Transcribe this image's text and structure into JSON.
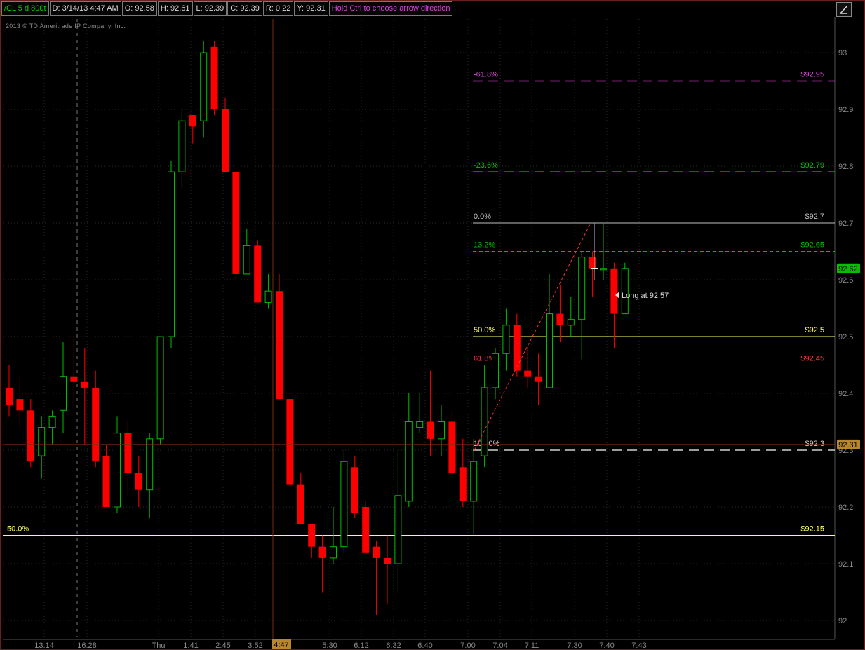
{
  "header": {
    "symbol": "/CL 5 d 800t",
    "date": "D: 3/14/13 4:47 AM",
    "open": "O: 92.58",
    "high": "H: 92.61",
    "low": "L: 92.39",
    "close": "C: 92.39",
    "range": "R: 0.22",
    "y": "Y: 92.31",
    "hint": "Hold Ctrl to choose arrow direction"
  },
  "copyright": "2013 © TD Ameritrade IP Company, Inc.",
  "cursor_label": "4:47",
  "annotation": "Long at 92.57",
  "colors": {
    "up": "#00c000",
    "down": "#ff0000",
    "background": "#000000"
  },
  "chart_data": {
    "type": "candlestick",
    "ylim": [
      91.98,
      93.08
    ],
    "y_ticks": [
      "93",
      "92.9",
      "92.8",
      "92.7",
      "92.6",
      "92.5",
      "92.4",
      "92.3",
      "92.2",
      "92.1",
      "92"
    ],
    "x_ticks": [
      "13:14",
      "16:28",
      "Thu",
      "1:41",
      "2:45",
      "3:52",
      "5:30",
      "6:12",
      "6:32",
      "6:40",
      "7:00",
      "7:04",
      "7:11",
      "7:30",
      "7:40",
      "7:43"
    ],
    "price_markers": [
      {
        "label": "92.62",
        "value": 92.62,
        "color": "#00c000"
      },
      {
        "label": "92.31",
        "value": 92.31,
        "color": "#b8862b"
      }
    ],
    "levels": [
      {
        "pct": "-61.8%",
        "price": "$92.95",
        "value": 92.95,
        "color": "#e040e0",
        "dash": "long",
        "scope": "right"
      },
      {
        "pct": "-23.6%",
        "price": "$92.79",
        "value": 92.79,
        "color": "#00c000",
        "dash": "long",
        "scope": "right"
      },
      {
        "pct": "0.0%",
        "price": "$92.7",
        "value": 92.7,
        "color": "#c0c0c0",
        "dash": "solid",
        "scope": "right"
      },
      {
        "pct": "13.2%",
        "price": "$92.65",
        "value": 92.65,
        "color": "#00c000",
        "dash": "short",
        "scope": "right"
      },
      {
        "pct": "50.0%",
        "price": "$92.5",
        "value": 92.5,
        "color": "#ffff66",
        "dash": "solid",
        "scope": "right"
      },
      {
        "pct": "61.8%",
        "price": "$92.45",
        "value": 92.45,
        "color": "#ff3030",
        "dash": "solid",
        "scope": "right"
      },
      {
        "pct": "100.0%",
        "price": "$92.3",
        "value": 92.3,
        "color": "#d0d0d0",
        "dash": "long",
        "scope": "right"
      },
      {
        "pct": "50.0%",
        "price": "$92.15",
        "value": 92.15,
        "color": "#ffff66",
        "dash": "solid",
        "scope": "full"
      }
    ],
    "candles": [
      {
        "o": 92.41,
        "h": 92.45,
        "l": 92.36,
        "c": 92.38
      },
      {
        "o": 92.39,
        "h": 92.43,
        "l": 92.34,
        "c": 92.37
      },
      {
        "o": 92.37,
        "h": 92.39,
        "l": 92.27,
        "c": 92.28
      },
      {
        "o": 92.29,
        "h": 92.36,
        "l": 92.25,
        "c": 92.34
      },
      {
        "o": 92.34,
        "h": 92.37,
        "l": 92.31,
        "c": 92.36
      },
      {
        "o": 92.37,
        "h": 92.49,
        "l": 92.33,
        "c": 92.43
      },
      {
        "o": 92.43,
        "h": 92.5,
        "l": 92.38,
        "c": 92.42
      },
      {
        "o": 92.42,
        "h": 92.48,
        "l": 92.31,
        "c": 92.41
      },
      {
        "o": 92.41,
        "h": 92.44,
        "l": 92.27,
        "c": 92.28
      },
      {
        "o": 92.29,
        "h": 92.31,
        "l": 92.2,
        "c": 92.2
      },
      {
        "o": 92.2,
        "h": 92.36,
        "l": 92.19,
        "c": 92.33
      },
      {
        "o": 92.33,
        "h": 92.35,
        "l": 92.22,
        "c": 92.26
      },
      {
        "o": 92.26,
        "h": 92.29,
        "l": 92.2,
        "c": 92.23
      },
      {
        "o": 92.23,
        "h": 92.33,
        "l": 92.18,
        "c": 92.32
      },
      {
        "o": 92.32,
        "h": 92.48,
        "l": 92.31,
        "c": 92.5
      },
      {
        "o": 92.5,
        "h": 92.81,
        "l": 92.48,
        "c": 92.79
      },
      {
        "o": 92.79,
        "h": 92.9,
        "l": 92.76,
        "c": 92.88
      },
      {
        "o": 92.89,
        "h": 92.89,
        "l": 92.84,
        "c": 92.87
      },
      {
        "o": 92.88,
        "h": 93.02,
        "l": 92.85,
        "c": 93.0
      },
      {
        "o": 93.01,
        "h": 93.02,
        "l": 92.89,
        "c": 92.9
      },
      {
        "o": 92.9,
        "h": 92.92,
        "l": 92.79,
        "c": 92.79
      },
      {
        "o": 92.79,
        "h": 92.79,
        "l": 92.6,
        "c": 92.61
      },
      {
        "o": 92.61,
        "h": 92.69,
        "l": 92.61,
        "c": 92.66
      },
      {
        "o": 92.66,
        "h": 92.67,
        "l": 92.56,
        "c": 92.56
      },
      {
        "o": 92.56,
        "h": 92.61,
        "l": 92.55,
        "c": 92.58
      },
      {
        "o": 92.58,
        "h": 92.61,
        "l": 92.39,
        "c": 92.39
      },
      {
        "o": 92.39,
        "h": 92.39,
        "l": 92.24,
        "c": 92.24
      },
      {
        "o": 92.24,
        "h": 92.26,
        "l": 92.17,
        "c": 92.17
      },
      {
        "o": 92.17,
        "h": 92.17,
        "l": 92.11,
        "c": 92.13
      },
      {
        "o": 92.13,
        "h": 92.15,
        "l": 92.05,
        "c": 92.11
      },
      {
        "o": 92.11,
        "h": 92.2,
        "l": 92.1,
        "c": 92.13
      },
      {
        "o": 92.13,
        "h": 92.3,
        "l": 92.12,
        "c": 92.28
      },
      {
        "o": 92.27,
        "h": 92.29,
        "l": 92.18,
        "c": 92.19
      },
      {
        "o": 92.2,
        "h": 92.21,
        "l": 92.12,
        "c": 92.12
      },
      {
        "o": 92.13,
        "h": 92.14,
        "l": 92.01,
        "c": 92.11
      },
      {
        "o": 92.11,
        "h": 92.15,
        "l": 92.03,
        "c": 92.1
      },
      {
        "o": 92.1,
        "h": 92.3,
        "l": 92.05,
        "c": 92.22
      },
      {
        "o": 92.21,
        "h": 92.4,
        "l": 92.2,
        "c": 92.35
      },
      {
        "o": 92.34,
        "h": 92.4,
        "l": 92.33,
        "c": 92.35
      },
      {
        "o": 92.35,
        "h": 92.44,
        "l": 92.29,
        "c": 92.32
      },
      {
        "o": 92.32,
        "h": 92.38,
        "l": 92.29,
        "c": 92.35
      },
      {
        "o": 92.35,
        "h": 92.37,
        "l": 92.25,
        "c": 92.26
      },
      {
        "o": 92.27,
        "h": 92.32,
        "l": 92.2,
        "c": 92.21
      },
      {
        "o": 92.21,
        "h": 92.32,
        "l": 92.15,
        "c": 92.28
      },
      {
        "o": 92.29,
        "h": 92.45,
        "l": 92.27,
        "c": 92.41
      },
      {
        "o": 92.41,
        "h": 92.48,
        "l": 92.39,
        "c": 92.47
      },
      {
        "o": 92.47,
        "h": 92.55,
        "l": 92.44,
        "c": 92.52
      },
      {
        "o": 92.52,
        "h": 92.54,
        "l": 92.43,
        "c": 92.44
      },
      {
        "o": 92.44,
        "h": 92.48,
        "l": 92.41,
        "c": 92.43
      },
      {
        "o": 92.43,
        "h": 92.47,
        "l": 92.38,
        "c": 92.42
      },
      {
        "o": 92.41,
        "h": 92.61,
        "l": 92.41,
        "c": 92.54
      },
      {
        "o": 92.54,
        "h": 92.59,
        "l": 92.49,
        "c": 92.52
      },
      {
        "o": 92.52,
        "h": 92.57,
        "l": 92.5,
        "c": 92.53
      },
      {
        "o": 92.53,
        "h": 92.65,
        "l": 92.46,
        "c": 92.64
      },
      {
        "o": 92.64,
        "h": 92.65,
        "l": 92.57,
        "c": 92.62
      },
      {
        "o": 92.62,
        "h": 92.7,
        "l": 92.6,
        "c": 92.62
      },
      {
        "o": 92.62,
        "h": 92.63,
        "l": 92.48,
        "c": 92.54
      },
      {
        "o": 92.54,
        "h": 92.63,
        "l": 92.54,
        "c": 92.62
      }
    ]
  }
}
